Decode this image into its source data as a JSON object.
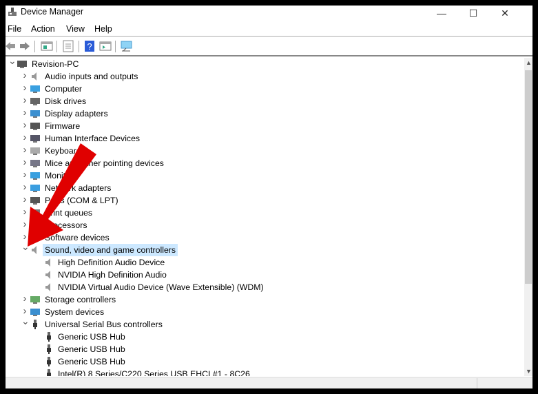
{
  "window": {
    "title": "Device Manager",
    "minimize": "—",
    "maximize": "☐",
    "close": "✕"
  },
  "menu": [
    "File",
    "Action",
    "View",
    "Help"
  ],
  "toolbar": [
    "back-icon",
    "forward-icon",
    "properties-icon",
    "show-hide-console-tree-icon",
    "help-icon",
    "action-pane-icon",
    "scan-hardware-icon"
  ],
  "tree": [
    {
      "level": 0,
      "caret": "expanded",
      "icon": "computer-icon",
      "label": "Revision-PC"
    },
    {
      "level": 1,
      "caret": "collapsed",
      "icon": "speaker-icon",
      "label": "Audio inputs and outputs"
    },
    {
      "level": 1,
      "caret": "collapsed",
      "icon": "monitor-icon",
      "label": "Computer"
    },
    {
      "level": 1,
      "caret": "collapsed",
      "icon": "disk-icon",
      "label": "Disk drives"
    },
    {
      "level": 1,
      "caret": "collapsed",
      "icon": "display-adapter-icon",
      "label": "Display adapters"
    },
    {
      "level": 1,
      "caret": "collapsed",
      "icon": "firmware-icon",
      "label": "Firmware"
    },
    {
      "level": 1,
      "caret": "collapsed",
      "icon": "hid-icon",
      "label": "Human Interface Devices"
    },
    {
      "level": 1,
      "caret": "collapsed",
      "icon": "keyboard-icon",
      "label": "Keyboards"
    },
    {
      "level": 1,
      "caret": "collapsed",
      "icon": "mouse-icon",
      "label": "Mice and other pointing devices"
    },
    {
      "level": 1,
      "caret": "collapsed",
      "icon": "monitor-icon",
      "label": "Monitors"
    },
    {
      "level": 1,
      "caret": "collapsed",
      "icon": "network-icon",
      "label": "Network adapters"
    },
    {
      "level": 1,
      "caret": "collapsed",
      "icon": "port-icon",
      "label": "Ports (COM & LPT)"
    },
    {
      "level": 1,
      "caret": "collapsed",
      "icon": "printer-icon",
      "label": "Print queues"
    },
    {
      "level": 1,
      "caret": "collapsed",
      "icon": "processor-icon",
      "label": "Processors"
    },
    {
      "level": 1,
      "caret": "collapsed",
      "icon": "software-icon",
      "label": "Software devices"
    },
    {
      "level": 1,
      "caret": "expanded",
      "icon": "speaker-icon",
      "label": "Sound, video and game controllers",
      "selected": true
    },
    {
      "level": 2,
      "icon": "speaker-icon",
      "label": "High Definition Audio Device"
    },
    {
      "level": 2,
      "icon": "speaker-icon",
      "label": "NVIDIA High Definition Audio"
    },
    {
      "level": 2,
      "icon": "speaker-icon",
      "label": "NVIDIA Virtual Audio Device (Wave Extensible) (WDM)"
    },
    {
      "level": 1,
      "caret": "collapsed",
      "icon": "storage-icon",
      "label": "Storage controllers"
    },
    {
      "level": 1,
      "caret": "collapsed",
      "icon": "system-icon",
      "label": "System devices"
    },
    {
      "level": 1,
      "caret": "expanded",
      "icon": "usb-icon",
      "label": "Universal Serial Bus controllers"
    },
    {
      "level": 2,
      "icon": "usb-icon",
      "label": "Generic USB Hub"
    },
    {
      "level": 2,
      "icon": "usb-icon",
      "label": "Generic USB Hub"
    },
    {
      "level": 2,
      "icon": "usb-icon",
      "label": "Generic USB Hub"
    },
    {
      "level": 2,
      "icon": "usb-icon",
      "label": "Intel(R) 8 Series/C220 Series USB EHCI #1 - 8C26"
    }
  ],
  "colors": {
    "selection": "#cce8ff",
    "arrow": "#e00000"
  }
}
